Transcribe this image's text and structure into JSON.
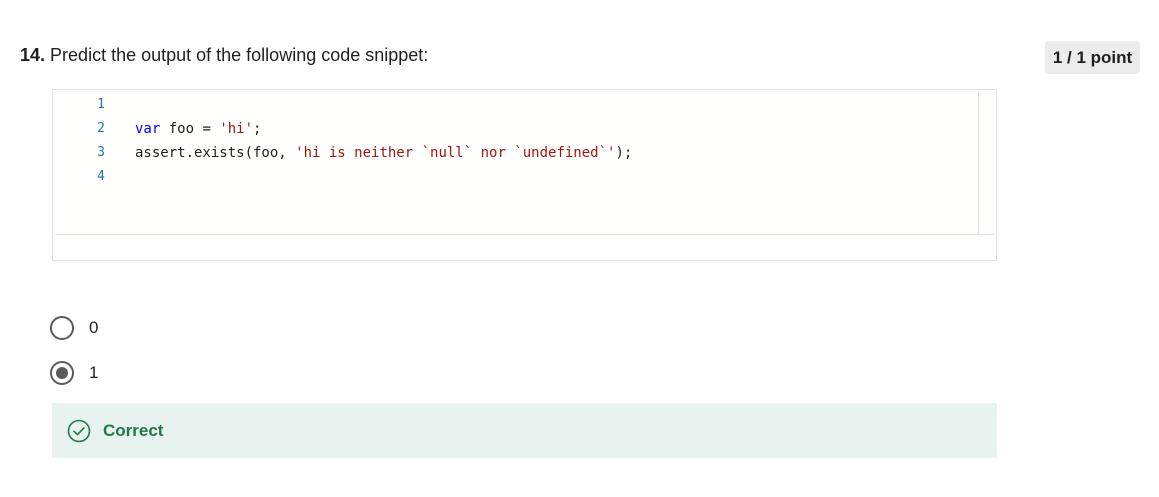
{
  "question": {
    "number": "14.",
    "prompt": "Predict the output of the following code snippet:",
    "points": "1 / 1 point"
  },
  "code": {
    "line_numbers": [
      "1",
      "2",
      "3",
      "4"
    ],
    "line2": {
      "keyword": "var",
      "rest": " foo = ",
      "string": "'hi'",
      "end": ";"
    },
    "line3": {
      "prefix": "assert.exists(foo, ",
      "string": "'hi is neither `null` nor `undefined`'",
      "end": ");"
    }
  },
  "options": [
    {
      "label": "0",
      "selected": false
    },
    {
      "label": "1",
      "selected": true
    }
  ],
  "feedback": {
    "status": "Correct",
    "icon": "check-circle-icon",
    "color": "#1d7a47"
  },
  "colors": {
    "keyword": "#0000ff",
    "string": "#a31515",
    "line_number": "#237893",
    "feedback_bg": "#e8f2ee"
  }
}
